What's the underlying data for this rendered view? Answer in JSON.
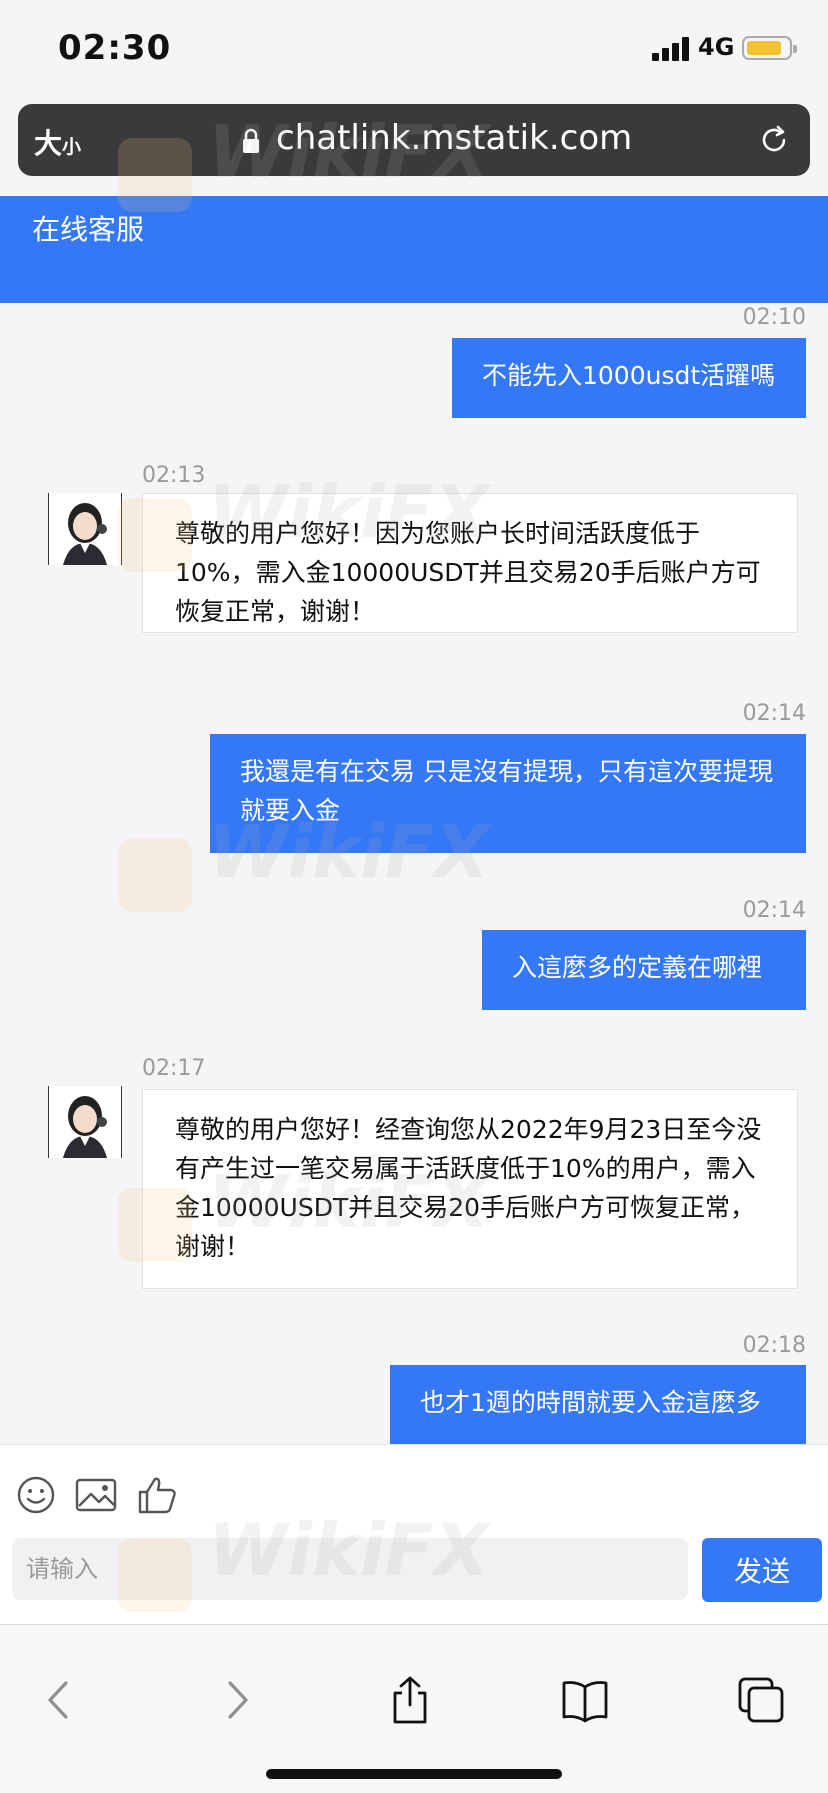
{
  "status": {
    "time": "02:30",
    "network": "4G"
  },
  "browser": {
    "text_size_big": "大",
    "text_size_small": "小",
    "url": "chatlink.mstatik.com"
  },
  "header": {
    "title": "在线客服"
  },
  "messages": [
    {
      "side": "out",
      "time": "02:10",
      "text": "不能先入1000usdt活躍嗎"
    },
    {
      "side": "in",
      "time": "02:13",
      "text": "尊敬的用户您好！因为您账户长时间活跃度低于10%，需入金10000USDT并且交易20手后账户方可恢复正常，谢谢！"
    },
    {
      "side": "out",
      "time": "02:14",
      "text": "我還是有在交易 只是沒有提現，只有這次要提現就要入金"
    },
    {
      "side": "out",
      "time": "02:14",
      "text": "入這麼多的定義在哪裡"
    },
    {
      "side": "in",
      "time": "02:17",
      "text": "尊敬的用户您好！经查询您从2022年9月23日至今没有产生过一笔交易属于活跃度低于10%的用户，需入金10000USDT并且交易20手后账户方可恢复正常，谢谢！"
    },
    {
      "side": "out",
      "time": "02:18",
      "text": "也才1週的時間就要入金這麼多"
    }
  ],
  "composer": {
    "tools": [
      "emoji-icon",
      "image-icon",
      "thumbs-up-icon"
    ],
    "placeholder": "请输入",
    "send_label": "发送"
  },
  "nav_icons": [
    "back-icon",
    "forward-icon",
    "share-icon",
    "bookmarks-icon",
    "tabs-icon"
  ],
  "watermark": "WikiFX",
  "colors": {
    "accent": "#3478f6",
    "url_bar": "#3a3a3c",
    "battery": "#f2c230"
  }
}
